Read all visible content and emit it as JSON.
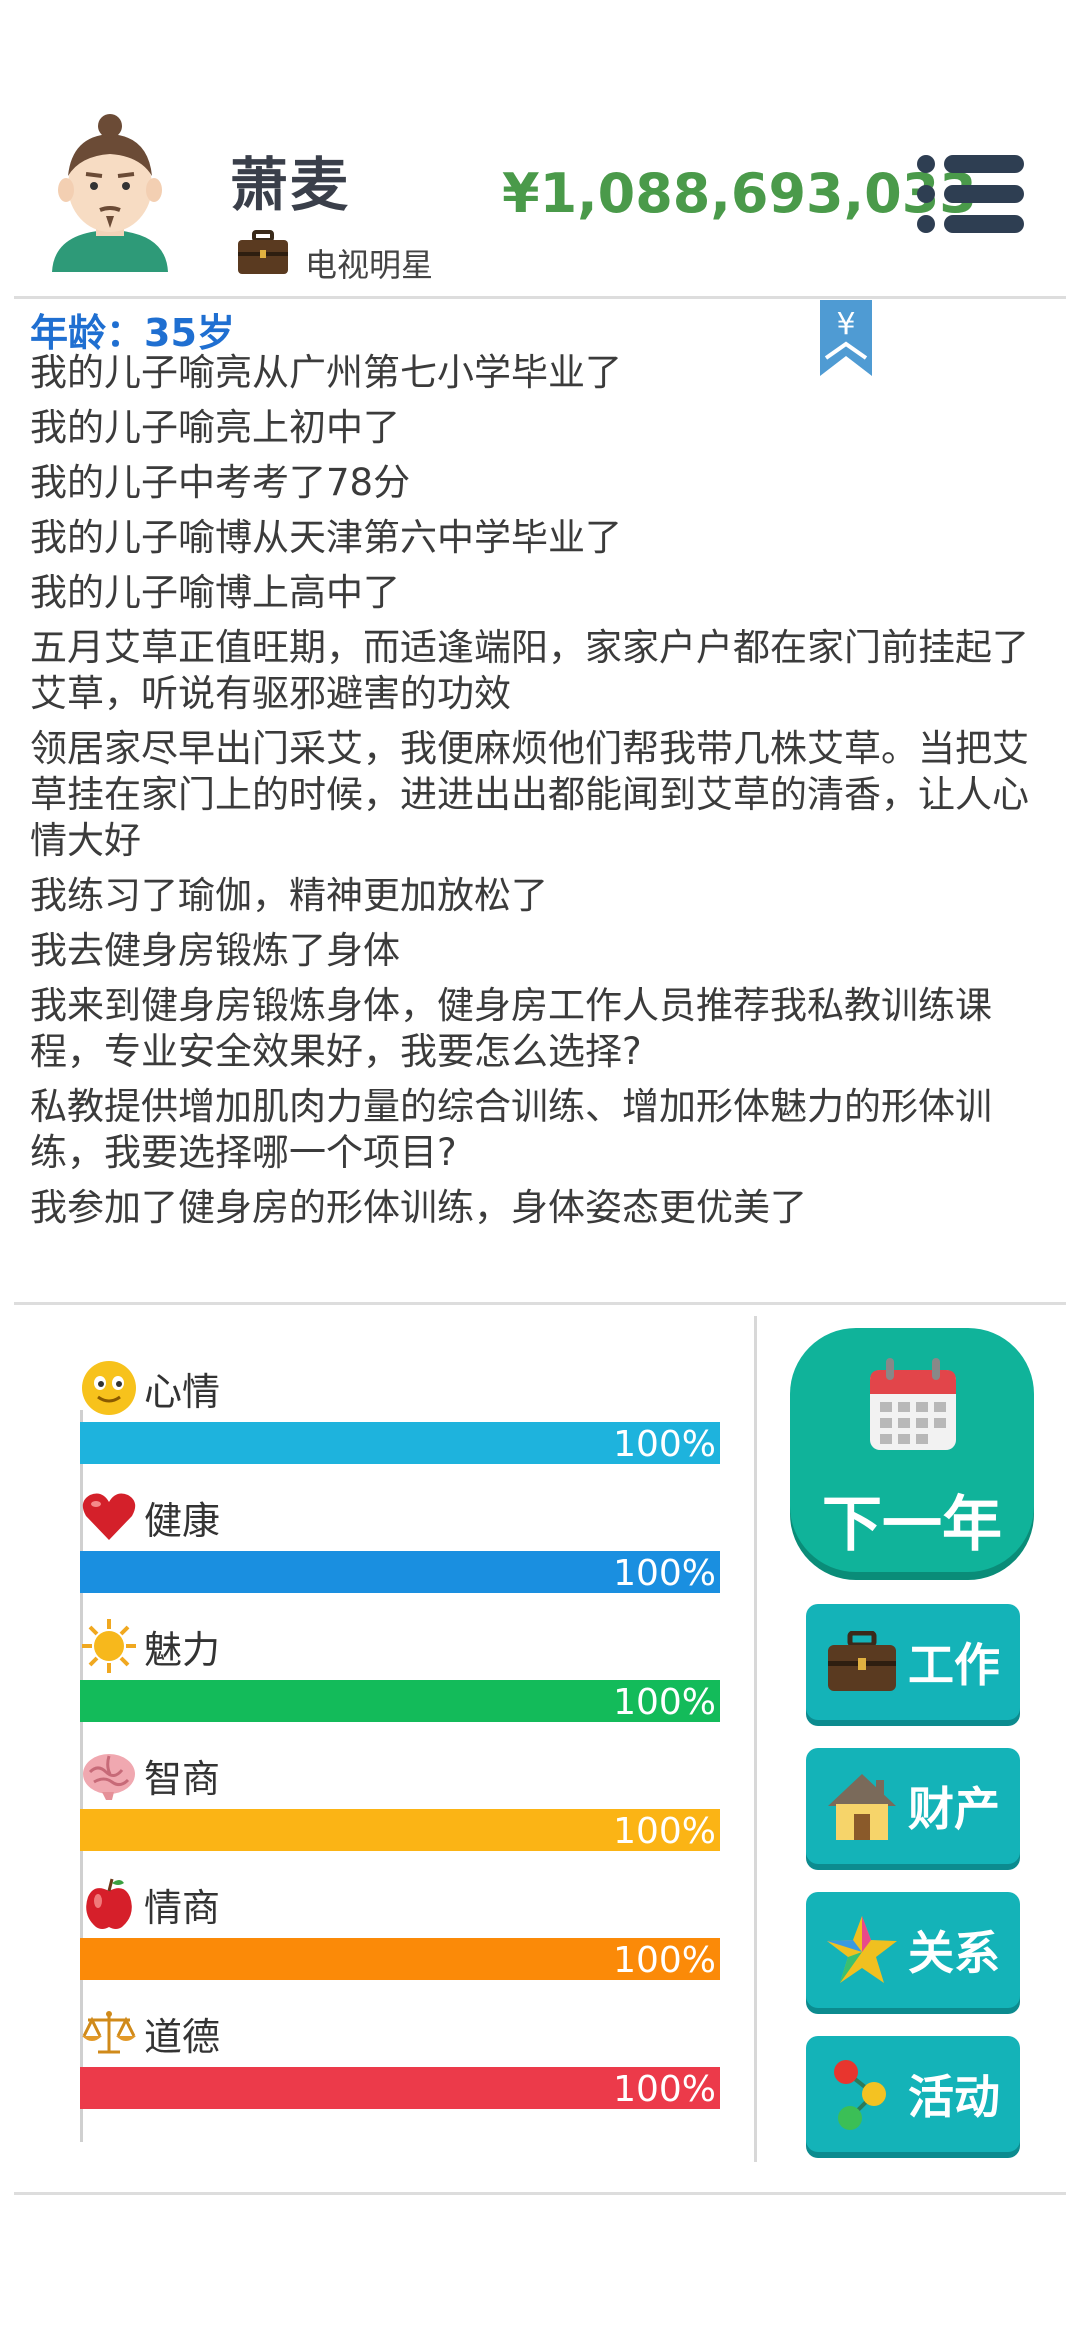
{
  "player": {
    "name": "萧麦",
    "job": "电视明星",
    "money": "¥1,088,693,033",
    "age": "年龄：35岁"
  },
  "log": [
    "我的儿子喻亮从广州第七小学毕业了",
    "我的儿子喻亮上初中了",
    "我的儿子中考考了78分",
    "我的儿子喻博从天津第六中学毕业了",
    "我的儿子喻博上高中了",
    "五月艾草正值旺期，而适逢端阳，家家户户都在家门前挂起了艾草，听说有驱邪避害的功效",
    "领居家尽早出门采艾，我便麻烦他们帮我带几株艾草。当把艾草挂在家门上的时候，进进出出都能闻到艾草的清香，让人心情大好",
    "我练习了瑜伽，精神更加放松了",
    "我去健身房锻炼了身体",
    "我来到健身房锻炼身体，健身房工作人员推荐我私教训练课程，专业安全效果好，我要怎么选择?",
    "私教提供增加肌肉力量的综合训练、增加形体魅力的形体训练，我要选择哪一个项目?",
    "我参加了健身房的形体训练，身体姿态更优美了"
  ],
  "stats": [
    {
      "name": "心情",
      "value": "100%",
      "level": 1.0,
      "color": "#1eb3dd",
      "icon": "smiley-icon"
    },
    {
      "name": "健康",
      "value": "100%",
      "level": 1.0,
      "color": "#1a8fe0",
      "icon": "heart-icon"
    },
    {
      "name": "魅力",
      "value": "100%",
      "level": 1.0,
      "color": "#13bb5a",
      "icon": "sun-icon"
    },
    {
      "name": "智商",
      "value": "100%",
      "level": 1.0,
      "color": "#fbb415",
      "icon": "brain-icon"
    },
    {
      "name": "情商",
      "value": "100%",
      "level": 1.0,
      "color": "#fb8a08",
      "icon": "apple-icon"
    },
    {
      "name": "道德",
      "value": "100%",
      "level": 1.0,
      "color": "#ec3a4a",
      "icon": "scales-icon"
    }
  ],
  "buttons": {
    "next_year": "下一年",
    "work": "工作",
    "property": "财产",
    "relations": "关系",
    "activities": "活动"
  },
  "colors": {
    "money": "#4a9a4a",
    "age": "#1f6fd1",
    "next_year_bg": "#10b39a",
    "action_bg": "#14b3b8"
  },
  "icons": {
    "bookmark": "yen-bookmark-icon",
    "menu": "hamburger-menu-icon",
    "job": "briefcase-icon"
  }
}
